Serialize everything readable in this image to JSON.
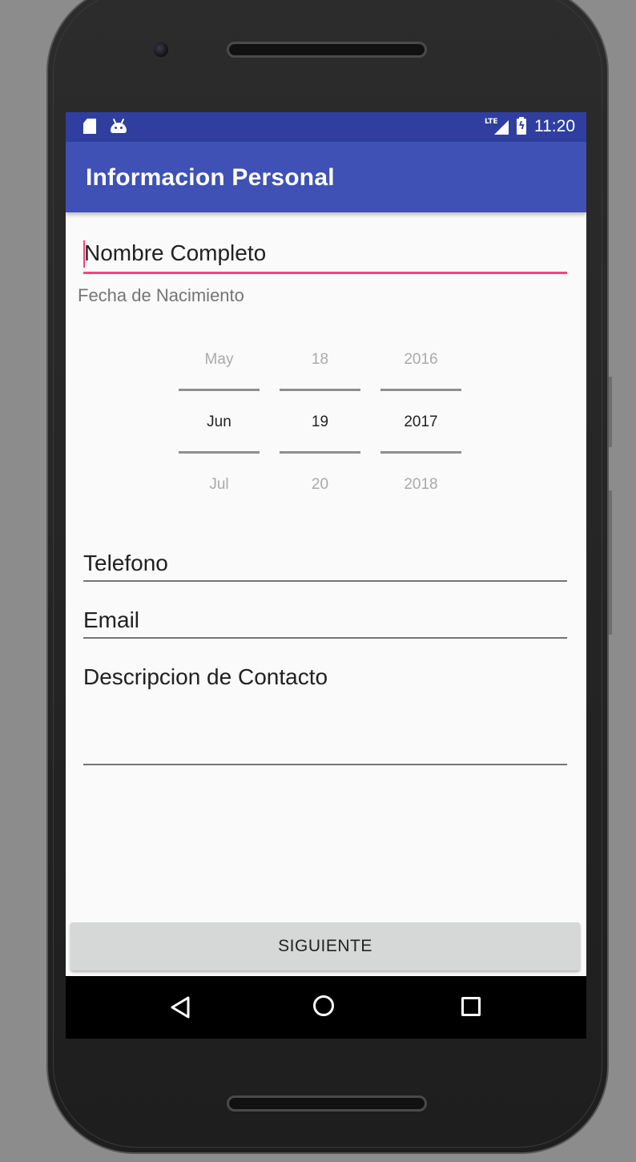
{
  "status_bar": {
    "network": "LTE",
    "time": "11:20"
  },
  "app_bar": {
    "title": "Informacion Personal"
  },
  "form": {
    "nombre_hint": "Nombre Completo",
    "fecha_label": "Fecha de Nacimiento",
    "date_picker": {
      "month": {
        "prev": "May",
        "current": "Jun",
        "next": "Jul"
      },
      "day": {
        "prev": "18",
        "current": "19",
        "next": "20"
      },
      "year": {
        "prev": "2016",
        "current": "2017",
        "next": "2018"
      }
    },
    "telefono_hint": "Telefono",
    "email_hint": "Email",
    "descripcion_hint": "Descripcion de Contacto",
    "next_button": "SIGUIENTE"
  },
  "colors": {
    "primary": "#3f51b5",
    "primary_dark": "#303f9f",
    "accent": "#ff4081"
  },
  "icons": {
    "status_left": [
      "sd-card-icon",
      "android-icon"
    ],
    "status_right": [
      "signal-icon",
      "battery-charging-icon"
    ],
    "nav": [
      "back-icon",
      "home-icon",
      "recents-icon"
    ]
  }
}
